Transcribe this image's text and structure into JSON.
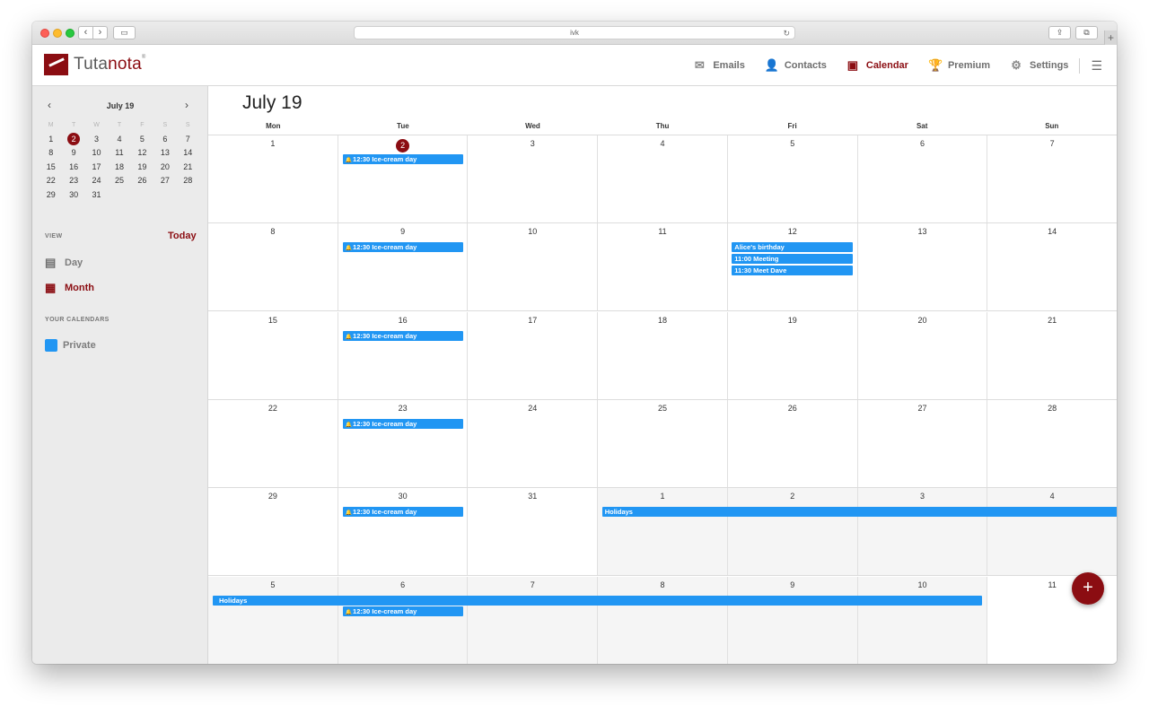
{
  "browser": {
    "url": "ivk"
  },
  "app": {
    "name_part1": "Tuta",
    "name_part2": "nota",
    "reg": "®"
  },
  "topnav": [
    {
      "label": "Emails",
      "icon": "mail-icon"
    },
    {
      "label": "Contacts",
      "icon": "person-icon"
    },
    {
      "label": "Calendar",
      "icon": "calendar-icon",
      "active": true
    },
    {
      "label": "Premium",
      "icon": "trophy-icon"
    },
    {
      "label": "Settings",
      "icon": "gear-icon"
    }
  ],
  "mini_calendar": {
    "title": "July 19",
    "weekdays": [
      "M",
      "T",
      "W",
      "T",
      "F",
      "S",
      "S"
    ],
    "weeks": [
      [
        "1",
        "2",
        "3",
        "4",
        "5",
        "6",
        "7"
      ],
      [
        "8",
        "9",
        "10",
        "11",
        "12",
        "13",
        "14"
      ],
      [
        "15",
        "16",
        "17",
        "18",
        "19",
        "20",
        "21"
      ],
      [
        "22",
        "23",
        "24",
        "25",
        "26",
        "27",
        "28"
      ],
      [
        "29",
        "30",
        "31",
        "",
        "",
        "",
        ""
      ]
    ],
    "today": "2"
  },
  "view": {
    "section_label": "VIEW",
    "today_label": "Today",
    "day_label": "Day",
    "month_label": "Month"
  },
  "calendars": {
    "section_label": "YOUR CALENDARS",
    "items": [
      {
        "name": "Private",
        "color": "#2196f3"
      }
    ]
  },
  "month": {
    "title": "July 19",
    "weekdays": [
      "Mon",
      "Tue",
      "Wed",
      "Thu",
      "Fri",
      "Sat",
      "Sun"
    ],
    "weeks": [
      [
        "1",
        "2",
        "3",
        "4",
        "5",
        "6",
        "7"
      ],
      [
        "8",
        "9",
        "10",
        "11",
        "12",
        "13",
        "14"
      ],
      [
        "15",
        "16",
        "17",
        "18",
        "19",
        "20",
        "21"
      ],
      [
        "22",
        "23",
        "24",
        "25",
        "26",
        "27",
        "28"
      ],
      [
        "29",
        "30",
        "31",
        "1",
        "2",
        "3",
        "4"
      ],
      [
        "5",
        "6",
        "7",
        "8",
        "9",
        "10",
        "11"
      ]
    ],
    "today": "2"
  },
  "events": {
    "icecream": "12:30 Ice-cream day",
    "birthday": "Alice's birthday",
    "meeting": "11:00 Meeting",
    "dave": "11:30 Meet Dave",
    "holidays": "Holidays"
  },
  "colors": {
    "accent": "#8b0d12",
    "event": "#2196f3"
  },
  "fab": {
    "label": "+"
  }
}
